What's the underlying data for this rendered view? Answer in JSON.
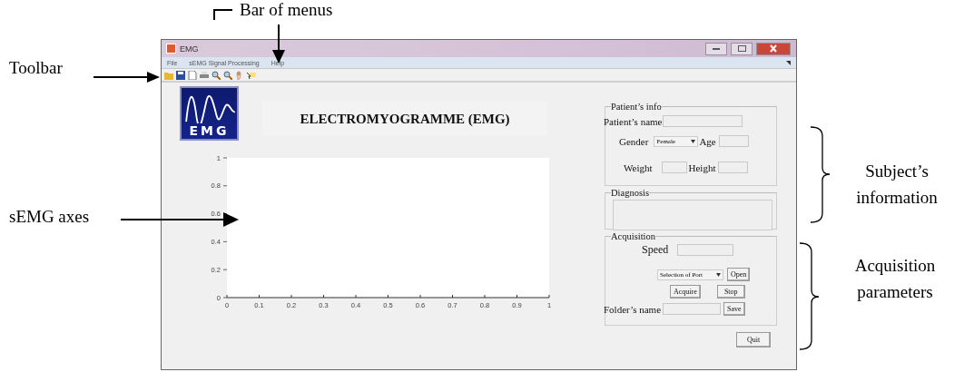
{
  "callouts": {
    "menu_bar": "Bar of menus",
    "toolbar": "Toolbar",
    "axes": "sEMG axes",
    "subject": "Subject’s information",
    "acquisition": "Acquisition parameters"
  },
  "window": {
    "title": "EMG",
    "menus": [
      "File",
      "sEMG Signal Processing",
      "Help"
    ]
  },
  "logo_text": "EMG",
  "heading": "ELECTROMYOGRAMME (EMG)",
  "chart_data": {
    "type": "line",
    "xlim": [
      0,
      1
    ],
    "ylim": [
      0,
      1
    ],
    "xticks": [
      0,
      0.1,
      0.2,
      0.3,
      0.4,
      0.5,
      0.6,
      0.7,
      0.8,
      0.9,
      1
    ],
    "yticks": [
      0,
      0.2,
      0.4,
      0.6,
      0.8,
      1
    ]
  },
  "patient_info": {
    "title": "Patient’s info",
    "name_label": "Patient’s name",
    "gender_label": "Gender",
    "gender_value": "Female",
    "age_label": "Age",
    "weight_label": "Weight",
    "height_label": "Height"
  },
  "diagnosis": {
    "title": "Diagnosis"
  },
  "acquisition": {
    "title": "Acquisition",
    "speed_label": "Speed",
    "port_value": "Selection of Port",
    "open_button": "Open",
    "acquire_button": "Acquire",
    "stop_button": "Stop",
    "folder_label": "Folder’s name",
    "save_button": "Save"
  },
  "quit_button": "Quit"
}
